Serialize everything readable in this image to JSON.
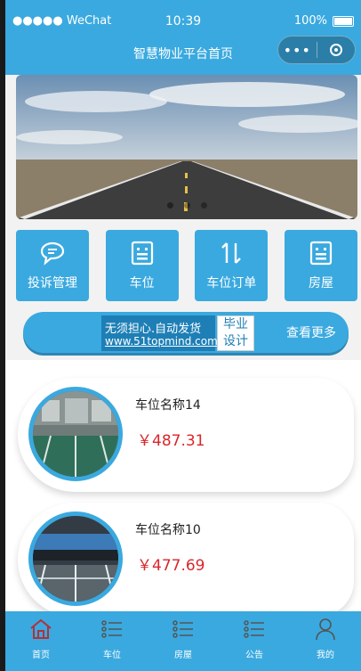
{
  "status": {
    "carrier": "●●●●● WeChat",
    "time": "10:39",
    "battery": "100%"
  },
  "nav": {
    "title": "智慧物业平台首页",
    "more_icon": "more-dots-icon",
    "close_icon": "target-icon"
  },
  "banner": {
    "slide_count": 3,
    "active_index": 0
  },
  "categories": [
    {
      "label": "投诉管理",
      "icon": "chat-bubble-icon"
    },
    {
      "label": "车位",
      "icon": "grid-card-icon"
    },
    {
      "label": "车位订单",
      "icon": "sort-arrows-icon"
    },
    {
      "label": "房屋",
      "icon": "grid-card-icon"
    }
  ],
  "more_bar": {
    "label": "查看更多",
    "watermark_line1": "无须担心.自动发货",
    "watermark_line2": "www.51topmind.com",
    "watermark_badge_1": "毕业",
    "watermark_badge_2": "设计"
  },
  "listings": [
    {
      "name": "车位名称14",
      "price": "￥487.31"
    },
    {
      "name": "车位名称10",
      "price": "￥477.69"
    }
  ],
  "tabbar": [
    {
      "label": "首页",
      "icon": "home-icon"
    },
    {
      "label": "车位",
      "icon": "list-icon"
    },
    {
      "label": "房屋",
      "icon": "list-icon"
    },
    {
      "label": "公告",
      "icon": "list-icon"
    },
    {
      "label": "我的",
      "icon": "person-icon"
    }
  ],
  "colors": {
    "primary": "#3aa9df",
    "price": "#d9262c"
  }
}
